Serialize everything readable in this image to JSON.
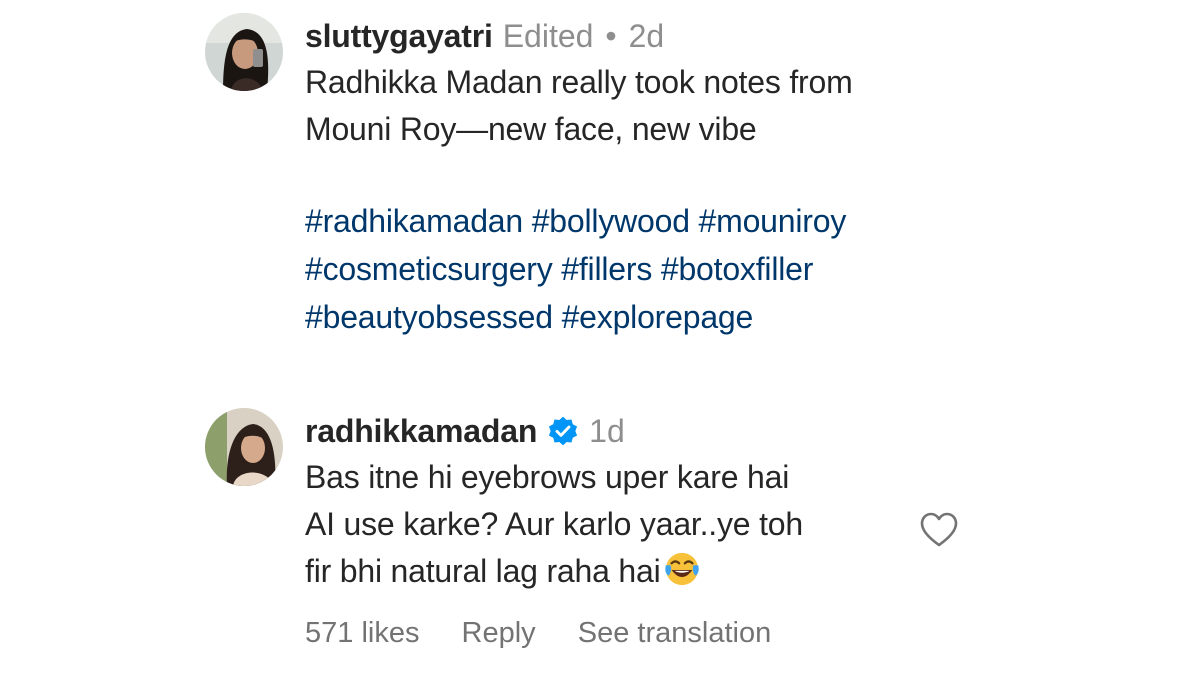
{
  "comments": [
    {
      "username": "sluttygayatri",
      "edited_label": "Edited",
      "separator": "•",
      "timestamp": "2d",
      "text_lines": [
        "Radhikka Madan really took notes from",
        "Mouni Roy—new face, new vibe"
      ],
      "hashtag_lines": [
        [
          "#radhikamadan",
          "#bollywood",
          "#mouniroy"
        ],
        [
          "#cosmeticsurgery",
          "#fillers",
          "#botoxfiller"
        ],
        [
          "#beautyobsessed",
          "#explorepage"
        ]
      ]
    },
    {
      "username": "radhikkamadan",
      "verified": true,
      "verified_icon": "verified-badge-icon",
      "timestamp": "1d",
      "text_lines": [
        "Bas itne hi eyebrows uper kare hai",
        "AI use karke? Aur karlo yaar..ye toh",
        "fir bhi natural lag raha hai"
      ],
      "emoji": "face-with-tears-of-joy",
      "likes_label": "571 likes",
      "reply_label": "Reply",
      "translation_label": "See translation",
      "like_icon": "heart-outline-icon"
    }
  ],
  "colors": {
    "text": "#262626",
    "meta": "#8e8e8e",
    "hashtag": "#00376b",
    "verified": "#0095f6",
    "actions": "#737373"
  }
}
